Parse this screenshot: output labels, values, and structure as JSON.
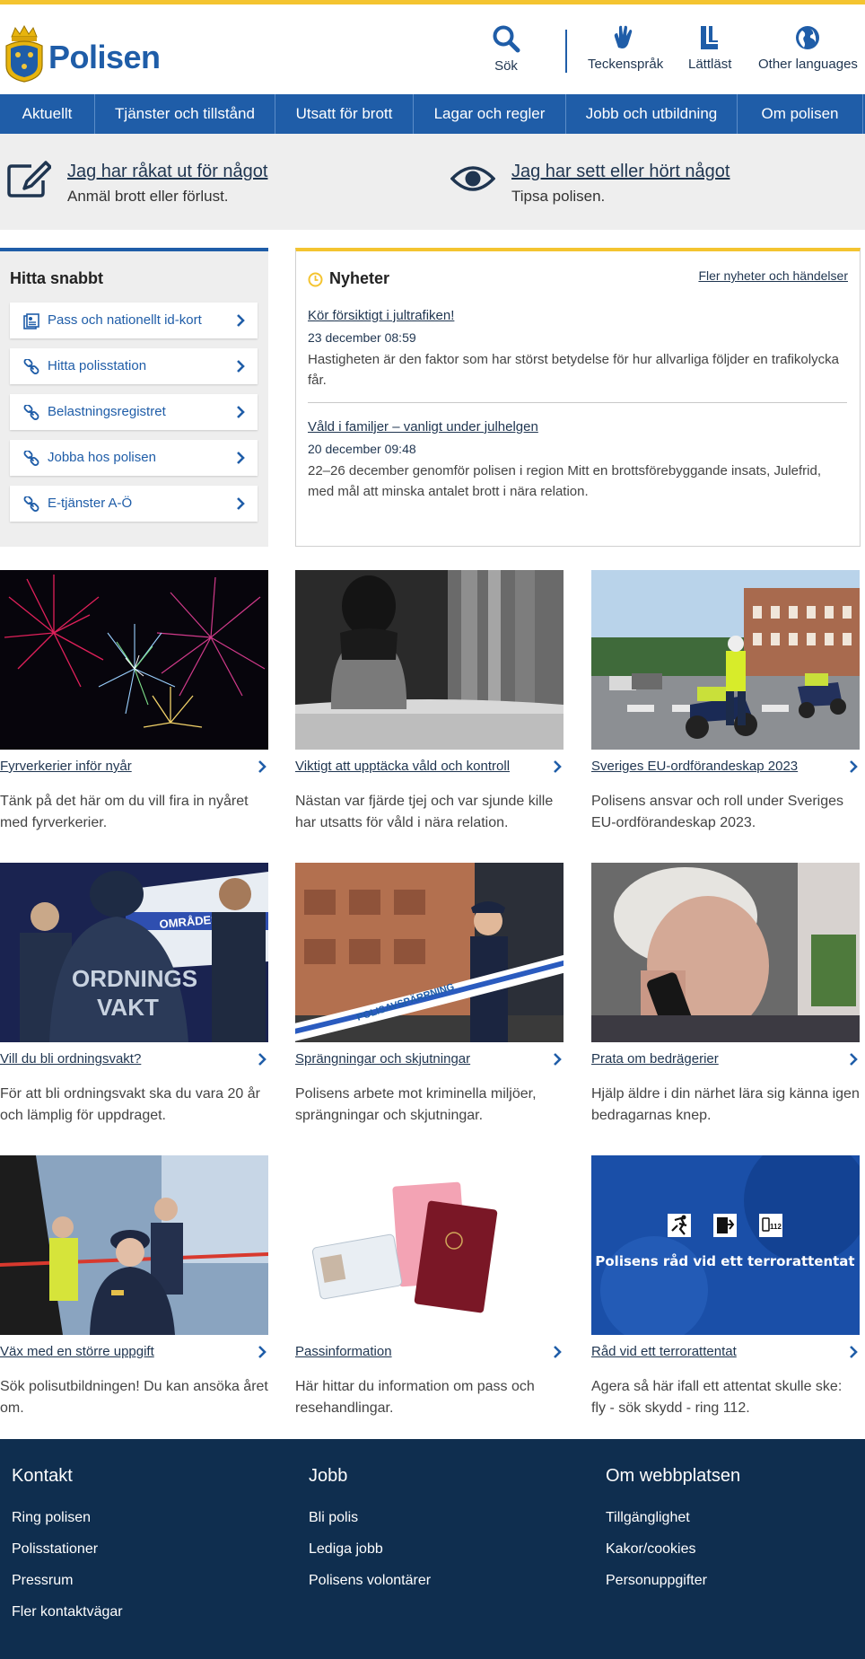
{
  "header": {
    "logo_text": "Polisen",
    "search_label": "Sök",
    "sign_language_label": "Teckenspråk",
    "easy_read_label": "Lättläst",
    "other_languages_label": "Other languages"
  },
  "nav": {
    "items": [
      "Aktuellt",
      "Tjänster och tillstånd",
      "Utsatt för brott",
      "Lagar och regler",
      "Jobb och utbildning",
      "Om polisen"
    ]
  },
  "hero": {
    "report": {
      "title": "Jag har råkat ut för något",
      "subtitle": "Anmäl brott eller förlust."
    },
    "tip": {
      "title": "Jag har sett eller hört något",
      "subtitle": "Tipsa polisen."
    }
  },
  "quick": {
    "heading": "Hitta snabbt",
    "links": [
      {
        "label": "Pass och nationellt id-kort",
        "icon": "id-card-icon"
      },
      {
        "label": "Hitta polisstation",
        "icon": "link-icon"
      },
      {
        "label": "Belastningsregistret",
        "icon": "link-icon"
      },
      {
        "label": "Jobba hos polisen",
        "icon": "link-icon"
      },
      {
        "label": "E-tjänster A-Ö",
        "icon": "link-icon"
      }
    ]
  },
  "news": {
    "heading": "Nyheter",
    "more_link": "Fler nyheter och händelser",
    "items": [
      {
        "title": "Kör försiktigt i jultrafiken!",
        "date": "23 december 08:59",
        "text": "Hastigheten är den faktor som har störst betydelse för hur allvarliga följder en trafikolycka får."
      },
      {
        "title": "Våld i familjer – vanligt under julhelgen",
        "date": "20 december 09:48",
        "text": "22–26 december genomför polisen i region Mitt en brottsförebyggande insats, Julefrid, med mål att minska antalet brott i nära relation."
      }
    ]
  },
  "cards": [
    {
      "title": "Fyrverkerier inför nyår",
      "text": "Tänk på det här om du vill fira in nyåret med fyrverkerier."
    },
    {
      "title": "Viktigt att upptäcka våld och kontroll",
      "text": "Nästan var fjärde tjej och var sjunde kille har utsatts för våld i nära relation."
    },
    {
      "title": "Sveriges EU-ordförandeskap 2023",
      "text": "Polisens ansvar och roll under Sveriges EU-ordförandeskap 2023."
    },
    {
      "title": "Vill du bli ordningsvakt?",
      "text": "För att bli ordningsvakt ska du vara 20 år och lämplig för uppdraget."
    },
    {
      "title": "Sprängningar och skjutningar",
      "text": "Polisens arbete mot kriminella miljöer, sprängningar och skjutningar."
    },
    {
      "title": "Prata om bedrägerier",
      "text": "Hjälp äldre i din närhet lära sig känna igen bedragarnas knep."
    },
    {
      "title": "Väx med en större uppgift",
      "text": "Sök polisutbildningen! Du kan ansöka året om."
    },
    {
      "title": "Passinformation",
      "text": "Här hittar du information om pass och resehandlingar."
    },
    {
      "title": "Råd vid ett terrorattentat",
      "text": "Agera så här ifall ett attentat skulle ske: fly - sök skydd - ring 112."
    }
  ],
  "images": {
    "ordningsvakt_van_text": "OMRÅDESPOLIS",
    "ordningsvakt_vest_text": "ORDNINGS VAKT",
    "tape_text": "POLISAVSPÄRRNING",
    "terror_text": "Polisens råd vid ett terrorattentat",
    "terror_call": "112"
  },
  "footer": {
    "columns": [
      {
        "heading": "Kontakt",
        "links": [
          "Ring polisen",
          "Polisstationer",
          "Pressrum",
          "Fler kontaktvägar"
        ]
      },
      {
        "heading": "Jobb",
        "links": [
          "Bli polis",
          "Lediga jobb",
          "Polisens volontärer"
        ]
      },
      {
        "heading": "Om webbplatsen",
        "links": [
          "Tillgänglighet",
          "Kakor/cookies",
          "Personuppgifter"
        ]
      }
    ]
  },
  "colors": {
    "brand_blue": "#1f5da8",
    "accent_yellow": "#f4c430",
    "footer_navy": "#0f2e4f",
    "link_dark": "#1f3550"
  }
}
